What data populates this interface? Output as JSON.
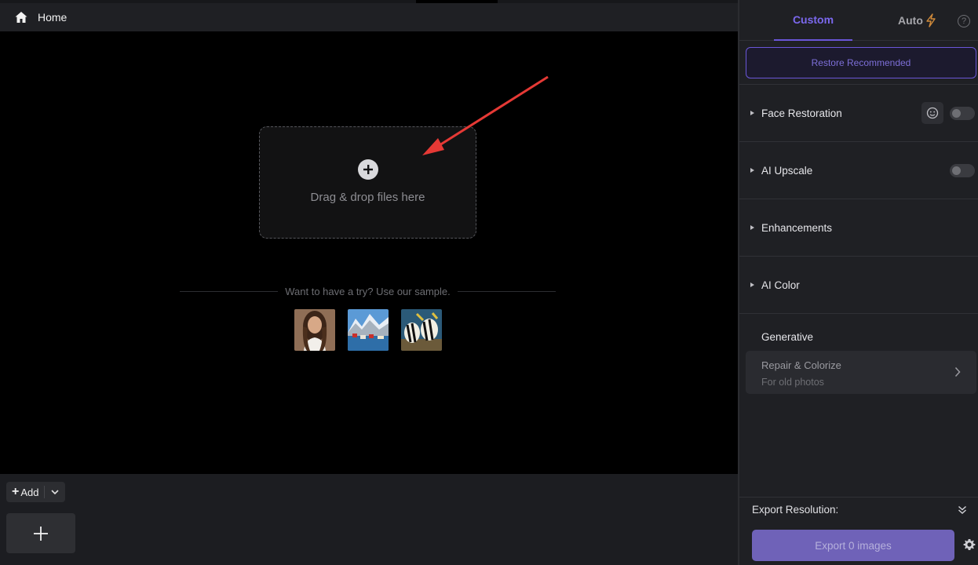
{
  "header": {
    "title": "Home",
    "icon": "home-icon"
  },
  "canvas": {
    "dropzone_text": "Drag & drop files here",
    "dropzone_icon": "plus-circle-icon",
    "sample_prompt": "Want to have a try? Use our sample.",
    "samples": [
      "portrait-sample",
      "landscape-sample",
      "fish-sample"
    ]
  },
  "bottom": {
    "add_label": "Add",
    "add_icon": "plus-icon",
    "caret_icon": "chevron-down-icon"
  },
  "panel": {
    "tabs": [
      {
        "label": "Custom",
        "active": true
      },
      {
        "label": "Auto",
        "icon": "bolt-icon",
        "active": false
      }
    ],
    "help_icon": "help-icon",
    "restore_label": "Restore Recommended",
    "sections": [
      {
        "label": "Face Restoration",
        "toggle": false,
        "has_face_icon": true
      },
      {
        "label": "AI Upscale",
        "toggle": false
      },
      {
        "label": "Enhancements"
      },
      {
        "label": "AI Color"
      }
    ],
    "generative": {
      "label": "Generative",
      "card_title": "Repair & Colorize",
      "card_subtitle": "For old photos"
    },
    "export": {
      "resolution_label": "Export Resolution:",
      "button_label": "Export 0 images"
    }
  },
  "colors": {
    "accent": "#6a56d8",
    "accent_text": "#7b68ee",
    "export_button": "#6f62b8",
    "arrow": "#e53935"
  }
}
